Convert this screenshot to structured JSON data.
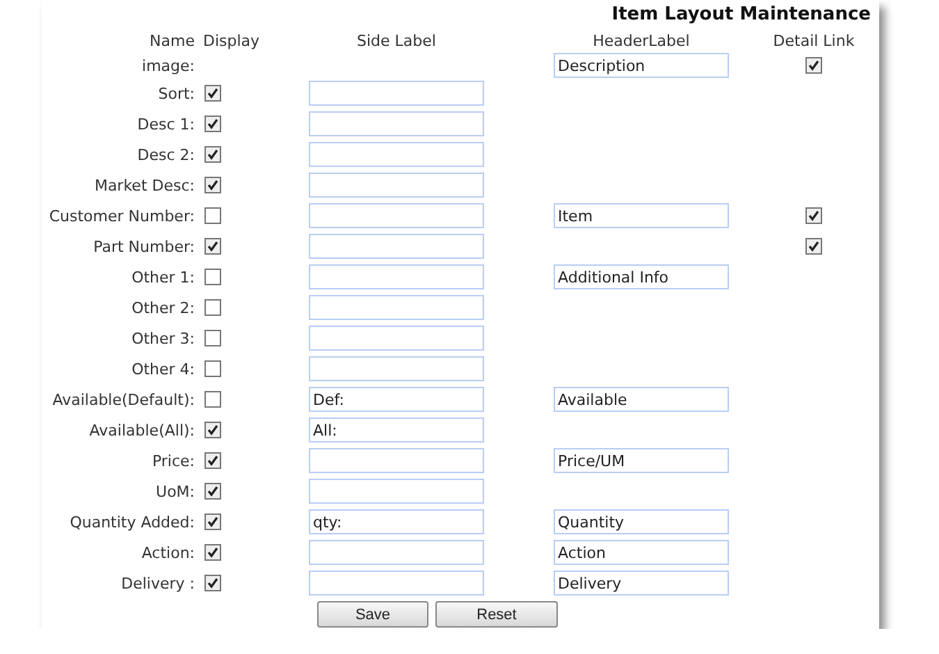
{
  "title": "Item Layout Maintenance",
  "columns": [
    "Name",
    "Display",
    "Side Label",
    "HeaderLabel",
    "Detail Link"
  ],
  "rows": [
    {
      "name": "image:",
      "side_field": false,
      "header_label": "Description",
      "detail_link": true
    },
    {
      "name": "Sort:",
      "display": true,
      "side_field": true,
      "detail_link": false
    },
    {
      "name": "Desc 1:",
      "display": true,
      "side_field": true,
      "detail_link": false
    },
    {
      "name": "Desc 2:",
      "display": true,
      "side_field": true,
      "detail_link": false
    },
    {
      "name": "Market Desc:",
      "display": true,
      "side_field": true,
      "detail_link": false
    },
    {
      "name": "Customer Number:",
      "display": false,
      "side_field": true,
      "header_label": "Item",
      "detail_link": true
    },
    {
      "name": "Part Number:",
      "display": true,
      "side_field": true,
      "detail_link": true
    },
    {
      "name": "Other 1:",
      "display": false,
      "side_field": true,
      "header_label": "Additional Info",
      "detail_link": false
    },
    {
      "name": "Other 2:",
      "display": false,
      "side_field": true,
      "detail_link": false
    },
    {
      "name": "Other 3:",
      "display": false,
      "side_field": true,
      "detail_link": false
    },
    {
      "name": "Other 4:",
      "display": false,
      "side_field": true,
      "detail_link": false
    },
    {
      "name": "Available(Default):",
      "display": false,
      "side_field": true,
      "side_label": "Def:",
      "header_label": "Available",
      "detail_link": false
    },
    {
      "name": "Available(All):",
      "display": true,
      "side_field": true,
      "side_label": "All:",
      "detail_link": false
    },
    {
      "name": "Price:",
      "display": true,
      "side_field": true,
      "header_label": "Price/UM",
      "detail_link": false
    },
    {
      "name": "UoM:",
      "display": true,
      "side_field": true,
      "detail_link": false
    },
    {
      "name": "Quantity Added:",
      "display": true,
      "side_field": true,
      "side_label": "qty:",
      "header_label": "Quantity",
      "detail_link": false
    },
    {
      "name": "Action:",
      "display": true,
      "side_field": true,
      "header_label": "Action",
      "detail_link": false
    },
    {
      "name": "Delivery :",
      "display": true,
      "side_field": true,
      "header_label": "Delivery",
      "detail_link": false
    }
  ],
  "buttons": [
    "Save",
    "Reset"
  ]
}
